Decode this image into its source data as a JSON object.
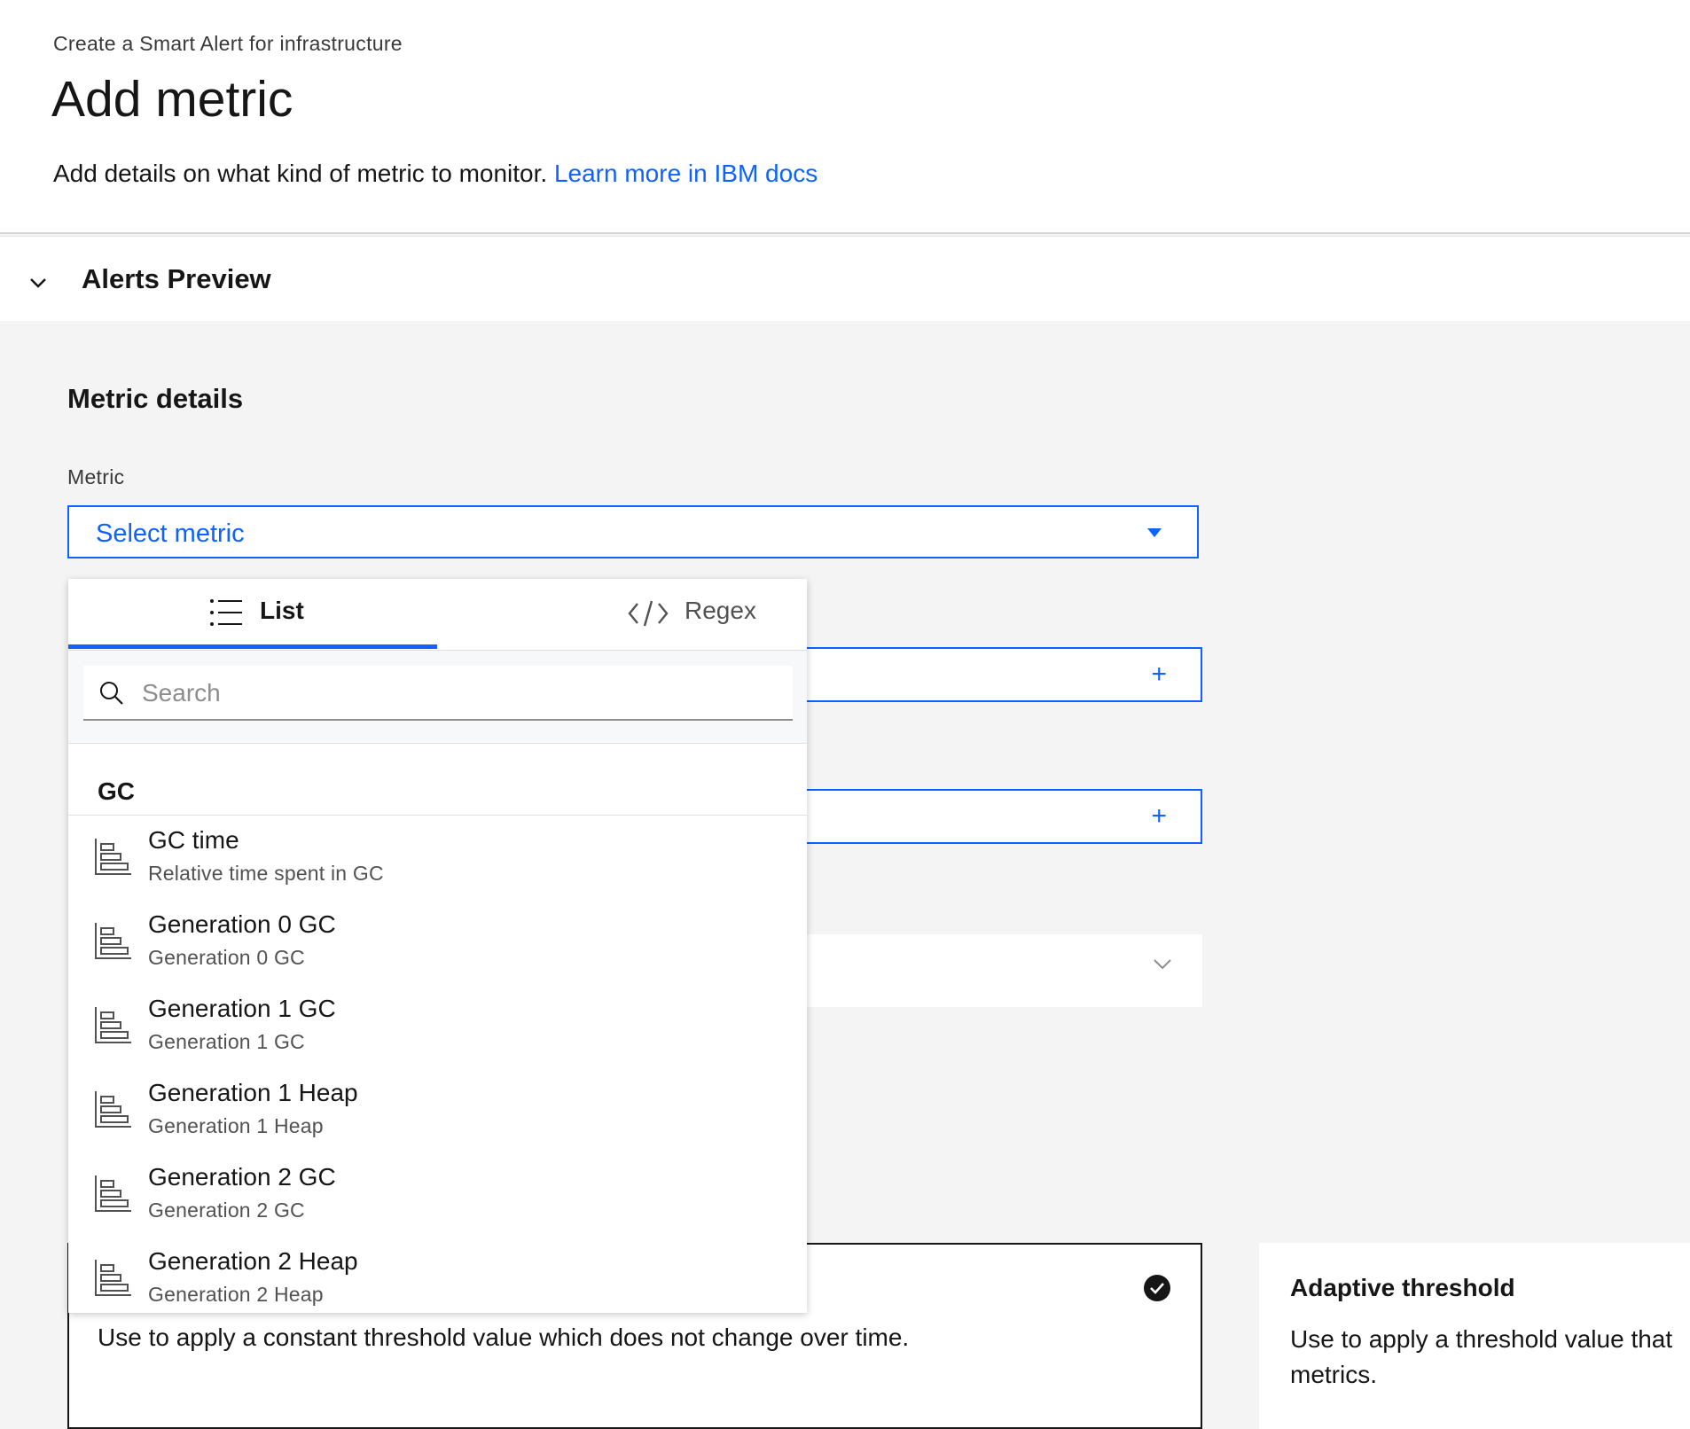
{
  "header": {
    "eyebrow": "Create a Smart Alert for infrastructure",
    "title": "Add metric",
    "description": "Add details on what kind of metric to monitor.",
    "link_text": "Learn more in IBM docs"
  },
  "preview": {
    "title": "Alerts Preview"
  },
  "metric_details": {
    "title": "Metric details",
    "metric_label": "Metric",
    "select_placeholder": "Select metric"
  },
  "dropdown": {
    "tabs": [
      {
        "label": "List",
        "icon": "list-icon",
        "selected": true
      },
      {
        "label": "Regex",
        "icon": "code-icon",
        "selected": false
      }
    ],
    "search_placeholder": "Search",
    "group": "GC",
    "items": [
      {
        "name": "GC time",
        "description": "Relative time spent in GC",
        "icon": "bar-chart-icon"
      },
      {
        "name": "Generation 0 GC",
        "description": "Generation 0 GC",
        "icon": "bar-chart-icon"
      },
      {
        "name": "Generation 1 GC",
        "description": "Generation 1 GC",
        "icon": "bar-chart-icon"
      },
      {
        "name": "Generation 1 Heap",
        "description": "Generation 1 Heap",
        "icon": "bar-chart-icon"
      },
      {
        "name": "Generation 2 GC",
        "description": "Generation 2 GC",
        "icon": "bar-chart-icon"
      },
      {
        "name": "Generation 2 Heap",
        "description": "Generation 2 Heap",
        "icon": "bar-chart-icon"
      }
    ]
  },
  "threshold": {
    "static_description": "Use to apply a constant threshold value which does not change over time.",
    "adaptive_title": "Adaptive threshold",
    "adaptive_description_line1": "Use to apply a threshold value that",
    "adaptive_description_line2": "metrics."
  },
  "colors": {
    "accent": "#0f62fe",
    "text": "#161616",
    "secondary_text": "#525252",
    "background": "#f4f4f4"
  }
}
